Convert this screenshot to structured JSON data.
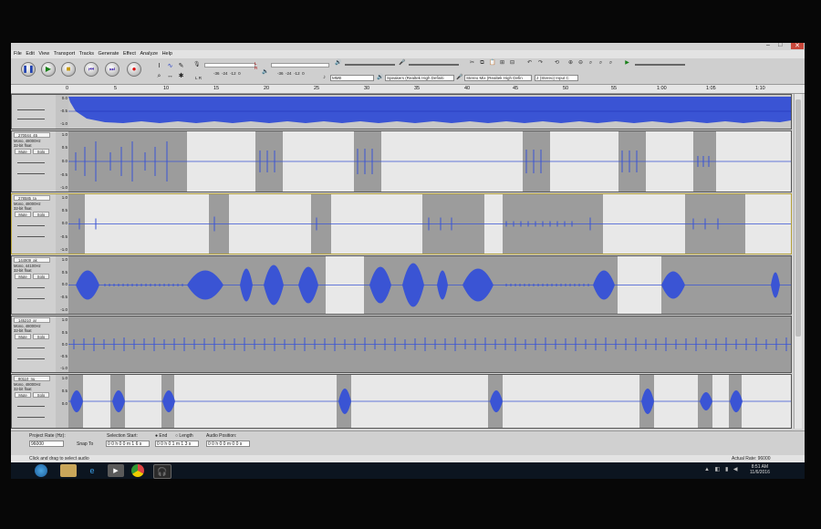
{
  "menu": [
    "File",
    "Edit",
    "View",
    "Transport",
    "Tracks",
    "Generate",
    "Effect",
    "Analyze",
    "Help"
  ],
  "window_controls": {
    "minimize": "–",
    "maximize": "□",
    "close": "✕"
  },
  "transport": {
    "pause": "❚❚",
    "play": "▶",
    "stop": "■",
    "skip_start": "⏮",
    "skip_end": "⏭",
    "record": "●",
    "pause_icon": "pause-icon",
    "play_icon": "play-icon",
    "stop_icon": "stop-icon",
    "skip_start_icon": "skip-start-icon",
    "skip_end_icon": "skip-end-icon",
    "record_icon": "record-icon"
  },
  "meters": {
    "record_scale": [
      "-36",
      "-24",
      "-12",
      "0"
    ],
    "play_scale": [
      "-36",
      "-24",
      "-12",
      "0"
    ],
    "record_lr": [
      "L",
      "R"
    ],
    "play_lr": [
      "L",
      "R"
    ]
  },
  "devices": {
    "host": "MME",
    "output": "Speakers (Realtek High Definiti",
    "input": "Stereo Mix (Realtek High Defin",
    "channels": "2 (Stereo) Input C"
  },
  "ruler": {
    "labels": [
      "0",
      "5",
      "10",
      "15",
      "20",
      "25",
      "30",
      "35",
      "40",
      "45",
      "50",
      "55",
      "1:00",
      "1:05",
      "1:10"
    ]
  },
  "tracks": [
    {
      "name": "",
      "info": [],
      "scale": [
        "0.0",
        "-0.5",
        "-1.0"
      ],
      "mute": "",
      "solo": ""
    },
    {
      "name": "270044_45",
      "info": [
        "Mono, 48000Hz",
        "32-bit float"
      ],
      "scale": [
        "1.0",
        "0.5",
        "0.0",
        "-0.5",
        "-1.0"
      ],
      "mute": "Mute",
      "solo": "Solo"
    },
    {
      "name": "278585_ta",
      "info": [
        "Mono, 48000Hz",
        "32-bit float"
      ],
      "scale": [
        "1.0",
        "0.5",
        "0.0",
        "-0.5",
        "-1.0"
      ],
      "mute": "Mute",
      "solo": "Solo"
    },
    {
      "name": "144909_ak",
      "info": [
        "Mono, 44100Hz",
        "32-bit float"
      ],
      "scale": [
        "1.0",
        "0.5",
        "0.0",
        "-0.5",
        "-1.0"
      ],
      "mute": "Mute",
      "solo": "Solo"
    },
    {
      "name": "145210_ar",
      "info": [
        "Mono, 48000Hz",
        "32-bit float"
      ],
      "scale": [
        "1.0",
        "0.5",
        "0.0",
        "-0.5",
        "-1.0"
      ],
      "mute": "Mute",
      "solo": "Solo"
    },
    {
      "name": "80110_nu",
      "info": [
        "Mono, 48000Hz",
        "32-bit float"
      ],
      "scale": [
        "1.0",
        "0.5",
        "0.0"
      ],
      "mute": "Mute",
      "solo": "Solo"
    }
  ],
  "selection": {
    "project_rate_label": "Project Rate (Hz):",
    "project_rate": "96000",
    "snap_label": "Snap To",
    "selection_start_label": "Selection Start:",
    "end_label": "End",
    "length_label": "Length",
    "audio_position_label": "Audio Position:",
    "start_value": "0 0 h 0 0 m 1 6 s",
    "end_value": "0 0 h 0 1 m 1 3 s",
    "position_value": "0 0 h 0 0 m 0 0 s"
  },
  "status": {
    "left": "Click and drag to select audio",
    "right": "Actual Rate: 96000"
  },
  "taskbar": {
    "time": "8:51 AM",
    "date": "11/6/2016"
  },
  "colors": {
    "wave": "#3a54d4",
    "wave_dark": "#1d2fb0",
    "track_bg": "#c8c8c8",
    "clip_light": "#e8e8e8",
    "clip_dark": "#9c9c9c",
    "selection_border": "#b6a23a"
  }
}
